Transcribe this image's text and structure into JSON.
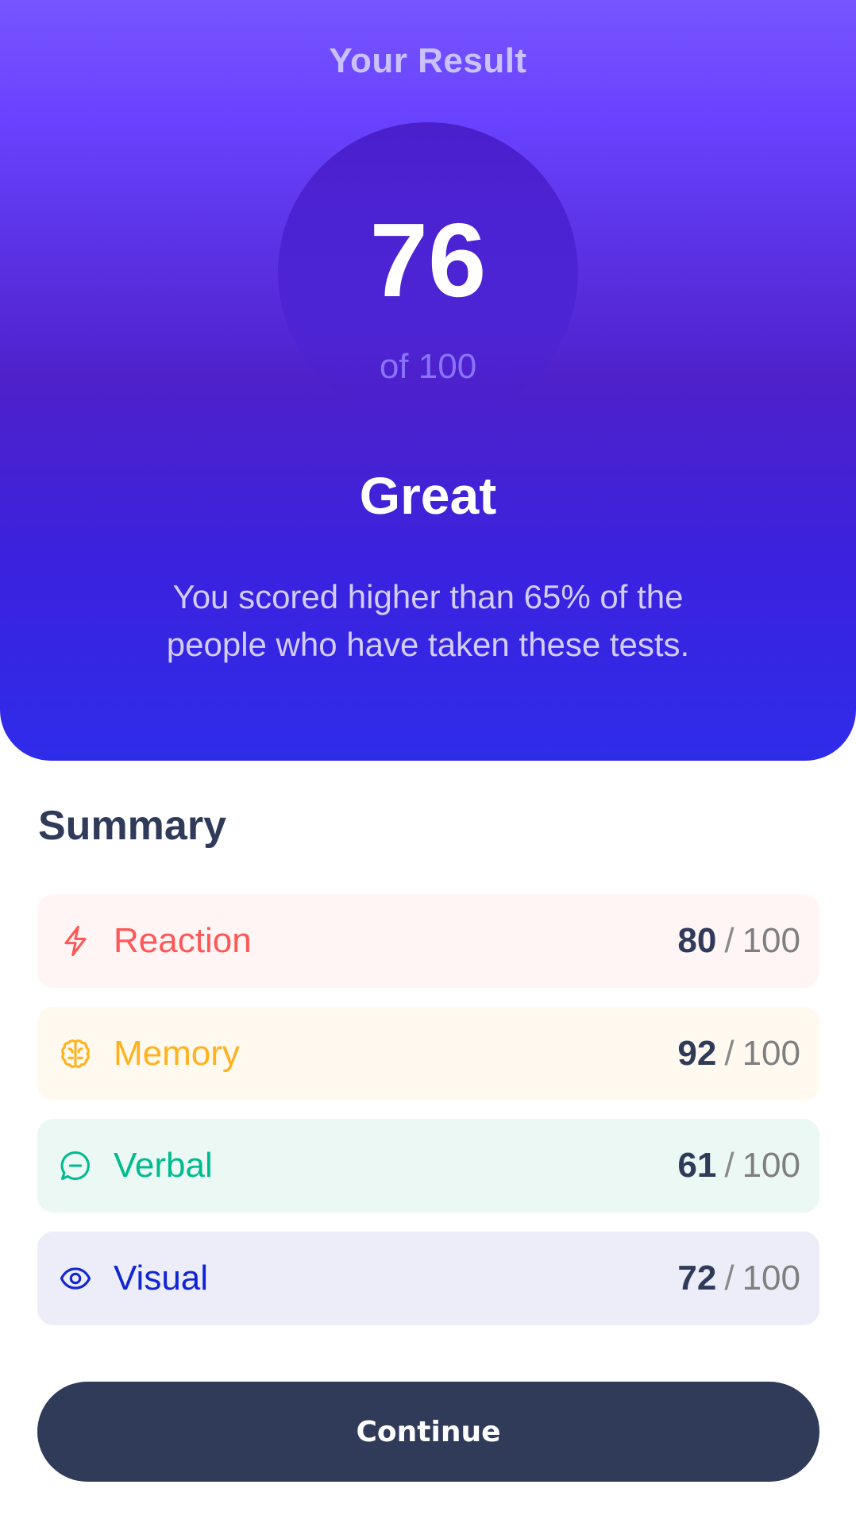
{
  "result": {
    "title": "Your Result",
    "score": "76",
    "out_of": "of 100",
    "rating": "Great",
    "description": "You scored higher than 65% of the people who have taken these tests."
  },
  "summary": {
    "title": "Summary",
    "items": [
      {
        "label": "Reaction",
        "score": "80",
        "separator": "/",
        "max": "100",
        "icon": "lightning-icon",
        "color": "#ff5757"
      },
      {
        "label": "Memory",
        "score": "92",
        "separator": "/",
        "max": "100",
        "icon": "brain-icon",
        "color": "#ffb21e"
      },
      {
        "label": "Verbal",
        "score": "61",
        "separator": "/",
        "max": "100",
        "icon": "chat-bubble-icon",
        "color": "#00bb8f"
      },
      {
        "label": "Visual",
        "score": "72",
        "separator": "/",
        "max": "100",
        "icon": "eye-icon",
        "color": "#1125d4"
      }
    ]
  },
  "actions": {
    "continue_label": "Continue"
  },
  "colors": {
    "gradient_top": "#7755ff",
    "gradient_bottom": "#2f2ce9",
    "dark_text": "#303b5a",
    "button_bg": "#303b5a"
  }
}
